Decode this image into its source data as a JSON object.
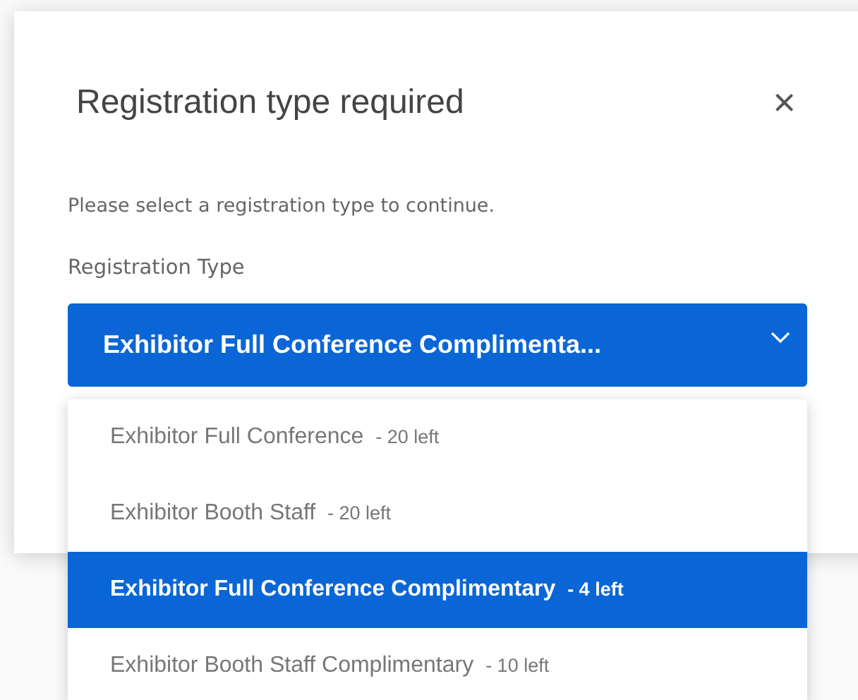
{
  "dialog": {
    "title": "Registration type required",
    "close": "×",
    "message": "Please select a registration type to continue.",
    "field_label": "Registration Type",
    "select": {
      "value": "Exhibitor Full Conference Complimenta...",
      "expanded": true
    },
    "options": [
      {
        "label": "Exhibitor Full Conference",
        "count": "- 20 left",
        "selected": false
      },
      {
        "label": "Exhibitor Booth Staff",
        "count": "- 20 left",
        "selected": false
      },
      {
        "label": "Exhibitor Full Conference Complimentary",
        "count": "- 4 left",
        "selected": true
      },
      {
        "label": "Exhibitor Booth Staff Complimentary",
        "count": "- 10 left",
        "selected": false
      }
    ]
  }
}
